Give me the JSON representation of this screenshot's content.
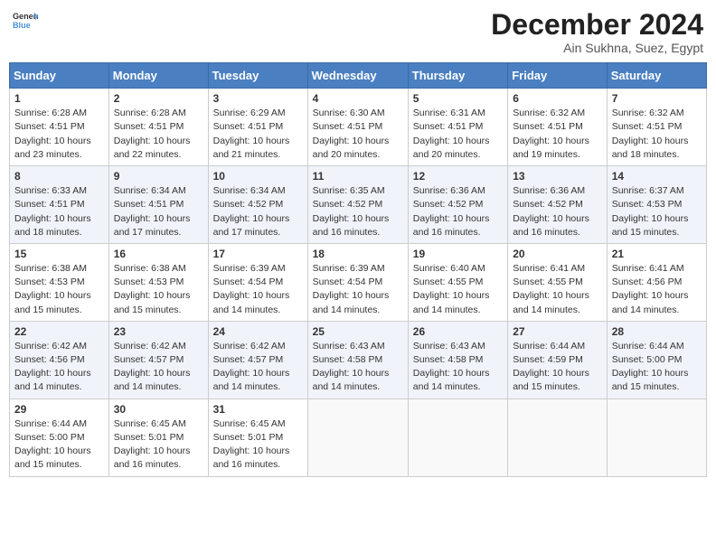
{
  "header": {
    "logo_general": "General",
    "logo_blue": "Blue",
    "month_title": "December 2024",
    "subtitle": "Ain Sukhna, Suez, Egypt"
  },
  "days_of_week": [
    "Sunday",
    "Monday",
    "Tuesday",
    "Wednesday",
    "Thursday",
    "Friday",
    "Saturday"
  ],
  "weeks": [
    [
      {
        "day": "1",
        "sunrise": "6:28 AM",
        "sunset": "4:51 PM",
        "daylight": "10 hours and 23 minutes."
      },
      {
        "day": "2",
        "sunrise": "6:28 AM",
        "sunset": "4:51 PM",
        "daylight": "10 hours and 22 minutes."
      },
      {
        "day": "3",
        "sunrise": "6:29 AM",
        "sunset": "4:51 PM",
        "daylight": "10 hours and 21 minutes."
      },
      {
        "day": "4",
        "sunrise": "6:30 AM",
        "sunset": "4:51 PM",
        "daylight": "10 hours and 20 minutes."
      },
      {
        "day": "5",
        "sunrise": "6:31 AM",
        "sunset": "4:51 PM",
        "daylight": "10 hours and 20 minutes."
      },
      {
        "day": "6",
        "sunrise": "6:32 AM",
        "sunset": "4:51 PM",
        "daylight": "10 hours and 19 minutes."
      },
      {
        "day": "7",
        "sunrise": "6:32 AM",
        "sunset": "4:51 PM",
        "daylight": "10 hours and 18 minutes."
      }
    ],
    [
      {
        "day": "8",
        "sunrise": "6:33 AM",
        "sunset": "4:51 PM",
        "daylight": "10 hours and 18 minutes."
      },
      {
        "day": "9",
        "sunrise": "6:34 AM",
        "sunset": "4:51 PM",
        "daylight": "10 hours and 17 minutes."
      },
      {
        "day": "10",
        "sunrise": "6:34 AM",
        "sunset": "4:52 PM",
        "daylight": "10 hours and 17 minutes."
      },
      {
        "day": "11",
        "sunrise": "6:35 AM",
        "sunset": "4:52 PM",
        "daylight": "10 hours and 16 minutes."
      },
      {
        "day": "12",
        "sunrise": "6:36 AM",
        "sunset": "4:52 PM",
        "daylight": "10 hours and 16 minutes."
      },
      {
        "day": "13",
        "sunrise": "6:36 AM",
        "sunset": "4:52 PM",
        "daylight": "10 hours and 16 minutes."
      },
      {
        "day": "14",
        "sunrise": "6:37 AM",
        "sunset": "4:53 PM",
        "daylight": "10 hours and 15 minutes."
      }
    ],
    [
      {
        "day": "15",
        "sunrise": "6:38 AM",
        "sunset": "4:53 PM",
        "daylight": "10 hours and 15 minutes."
      },
      {
        "day": "16",
        "sunrise": "6:38 AM",
        "sunset": "4:53 PM",
        "daylight": "10 hours and 15 minutes."
      },
      {
        "day": "17",
        "sunrise": "6:39 AM",
        "sunset": "4:54 PM",
        "daylight": "10 hours and 14 minutes."
      },
      {
        "day": "18",
        "sunrise": "6:39 AM",
        "sunset": "4:54 PM",
        "daylight": "10 hours and 14 minutes."
      },
      {
        "day": "19",
        "sunrise": "6:40 AM",
        "sunset": "4:55 PM",
        "daylight": "10 hours and 14 minutes."
      },
      {
        "day": "20",
        "sunrise": "6:41 AM",
        "sunset": "4:55 PM",
        "daylight": "10 hours and 14 minutes."
      },
      {
        "day": "21",
        "sunrise": "6:41 AM",
        "sunset": "4:56 PM",
        "daylight": "10 hours and 14 minutes."
      }
    ],
    [
      {
        "day": "22",
        "sunrise": "6:42 AM",
        "sunset": "4:56 PM",
        "daylight": "10 hours and 14 minutes."
      },
      {
        "day": "23",
        "sunrise": "6:42 AM",
        "sunset": "4:57 PM",
        "daylight": "10 hours and 14 minutes."
      },
      {
        "day": "24",
        "sunrise": "6:42 AM",
        "sunset": "4:57 PM",
        "daylight": "10 hours and 14 minutes."
      },
      {
        "day": "25",
        "sunrise": "6:43 AM",
        "sunset": "4:58 PM",
        "daylight": "10 hours and 14 minutes."
      },
      {
        "day": "26",
        "sunrise": "6:43 AM",
        "sunset": "4:58 PM",
        "daylight": "10 hours and 14 minutes."
      },
      {
        "day": "27",
        "sunrise": "6:44 AM",
        "sunset": "4:59 PM",
        "daylight": "10 hours and 15 minutes."
      },
      {
        "day": "28",
        "sunrise": "6:44 AM",
        "sunset": "5:00 PM",
        "daylight": "10 hours and 15 minutes."
      }
    ],
    [
      {
        "day": "29",
        "sunrise": "6:44 AM",
        "sunset": "5:00 PM",
        "daylight": "10 hours and 15 minutes."
      },
      {
        "day": "30",
        "sunrise": "6:45 AM",
        "sunset": "5:01 PM",
        "daylight": "10 hours and 16 minutes."
      },
      {
        "day": "31",
        "sunrise": "6:45 AM",
        "sunset": "5:01 PM",
        "daylight": "10 hours and 16 minutes."
      },
      null,
      null,
      null,
      null
    ]
  ],
  "labels": {
    "sunrise": "Sunrise:",
    "sunset": "Sunset:",
    "daylight": "Daylight:"
  }
}
